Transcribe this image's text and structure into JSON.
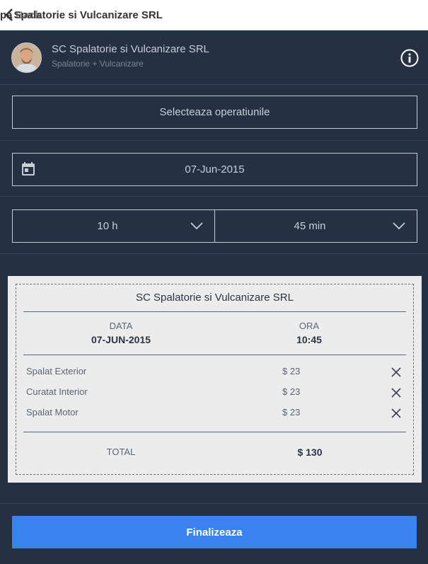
{
  "topbar": {
    "back_label": "Back",
    "title": "Spalatorie si Vulcanizare SRL",
    "title_prefix": "pa"
  },
  "business": {
    "name": "SC Spalatorie si Vulcanizare SRL",
    "category": "Spalatorie + Vulcanizare"
  },
  "form": {
    "operations_label": "Selecteaza operatiunile",
    "date": "07-Jun-2015",
    "hour": "10 h",
    "minute": "45 min"
  },
  "receipt": {
    "title": "SC Spalatorie si Vulcanizare SRL",
    "date_header": "DATA",
    "time_header": "ORA",
    "date_value": "07-JUN-2015",
    "time_value": "10:45",
    "items": [
      {
        "name": "Spalat Exterior",
        "price": "$ 23"
      },
      {
        "name": "Curatat Interior",
        "price": "$ 23"
      },
      {
        "name": "Spalat Motor",
        "price": "$ 23"
      }
    ],
    "total_label": "TOTAL",
    "total_value": "$ 130"
  },
  "actions": {
    "finalize_label": "Finalizeaza"
  },
  "colors": {
    "app_bg": "#253143",
    "accent": "#3a82f0",
    "receipt_bg": "#ececec"
  }
}
